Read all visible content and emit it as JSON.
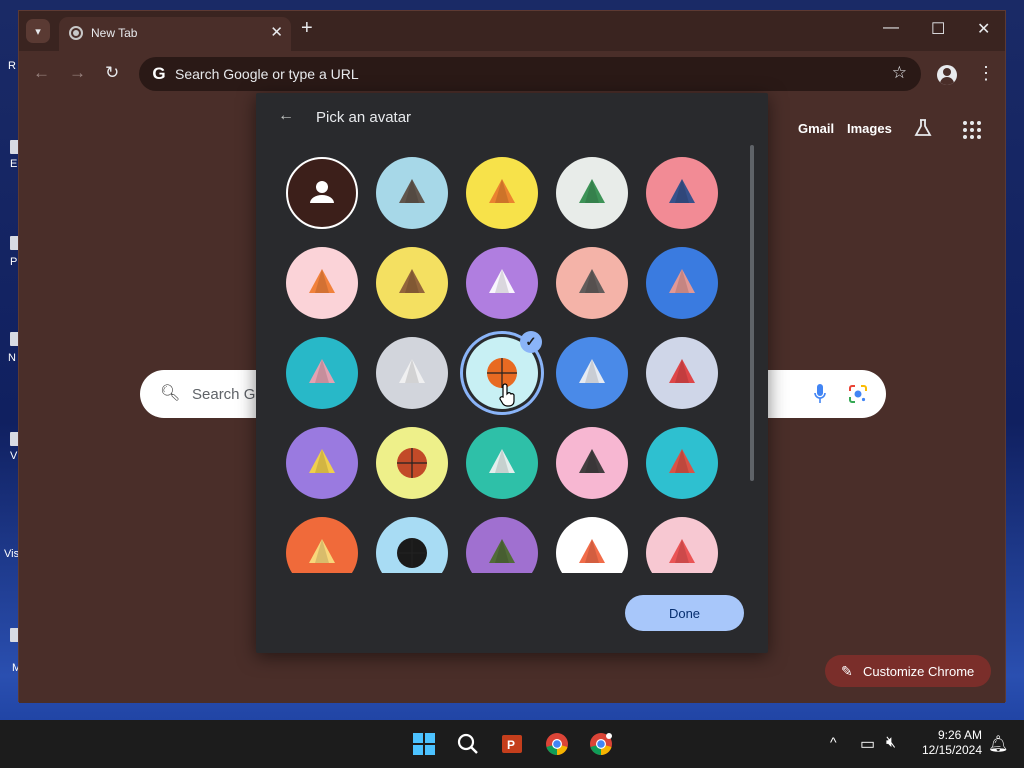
{
  "desktop": {
    "icon_labels": [
      "R",
      "E",
      "P",
      "N",
      "V",
      "Vis",
      "M"
    ]
  },
  "browser": {
    "tab": {
      "title": "New Tab",
      "close_glyph": "✕"
    },
    "new_tab_glyph": "+",
    "window_controls": {
      "minimize": "—",
      "maximize": "☐",
      "close": "✕"
    },
    "toolbar": {
      "back": "←",
      "forward": "→",
      "reload": "↻",
      "omnibox_placeholder": "Search Google or type a URL",
      "g_letter": "G",
      "bookmark_star": "☆",
      "menu": "⋮"
    },
    "ntp": {
      "gmail": "Gmail",
      "images": "Images",
      "search_placeholder": "Search Google or type a URL",
      "search_visible_text": "Search Go",
      "customize": "Customize Chrome"
    }
  },
  "dialog": {
    "title": "Pick an avatar",
    "back_glyph": "←",
    "done_label": "Done",
    "selected_index": 12,
    "avatars": [
      {
        "name": "default",
        "bg": "#3c1f1a",
        "fg": "#ffffff"
      },
      {
        "name": "cat",
        "bg": "#a7d8e8",
        "fg": "#5a4a3e"
      },
      {
        "name": "corgi",
        "bg": "#f7e24a",
        "fg": "#e87b2c"
      },
      {
        "name": "dragon",
        "bg": "#e8ece9",
        "fg": "#2e8b4a"
      },
      {
        "name": "elephant",
        "bg": "#f28b95",
        "fg": "#274c8a"
      },
      {
        "name": "fox",
        "bg": "#fbd3d8",
        "fg": "#f07a2e"
      },
      {
        "name": "monkey",
        "bg": "#f4e061",
        "fg": "#8a5a38"
      },
      {
        "name": "panda",
        "bg": "#b07ee0",
        "fg": "#ffffff"
      },
      {
        "name": "penguin",
        "bg": "#f4b3a8",
        "fg": "#555555"
      },
      {
        "name": "butterfly",
        "bg": "#3a7be0",
        "fg": "#f09a8e"
      },
      {
        "name": "rabbit",
        "bg": "#28b8c8",
        "fg": "#f2a0b0"
      },
      {
        "name": "unicorn",
        "bg": "#d2d5dc",
        "fg": "#f2f2f2"
      },
      {
        "name": "basketball",
        "bg": "#c8f0f4",
        "fg": "#e86a22"
      },
      {
        "name": "bike",
        "bg": "#4a8ae8",
        "fg": "#f2f2f2"
      },
      {
        "name": "bird",
        "bg": "#cfd6e8",
        "fg": "#e03a3a"
      },
      {
        "name": "cheese",
        "bg": "#9a7ae0",
        "fg": "#f6d640"
      },
      {
        "name": "football",
        "bg": "#eef08a",
        "fg": "#c24a28"
      },
      {
        "name": "burger",
        "bg": "#2ec0a8",
        "fg": "#f2f2f2"
      },
      {
        "name": "sunglasses",
        "bg": "#f7b7d2",
        "fg": "#333333"
      },
      {
        "name": "sushi",
        "bg": "#2ec0d0",
        "fg": "#e84a3a"
      },
      {
        "name": "tamagotchi",
        "bg": "#f06a3a",
        "fg": "#f8e080"
      },
      {
        "name": "vinyl",
        "bg": "#a8dcf4",
        "fg": "#1a1a1a"
      },
      {
        "name": "avocado",
        "bg": "#a070d0",
        "fg": "#4a6a2a"
      },
      {
        "name": "watermelon",
        "bg": "#ffffff",
        "fg": "#f0603a"
      },
      {
        "name": "icecream",
        "bg": "#f7c8d2",
        "fg": "#e84a4a"
      }
    ],
    "selected_check": "✓"
  },
  "taskbar": {
    "clock_time": "9:26 AM",
    "clock_date": "12/15/2024",
    "tray_caret": "^"
  }
}
